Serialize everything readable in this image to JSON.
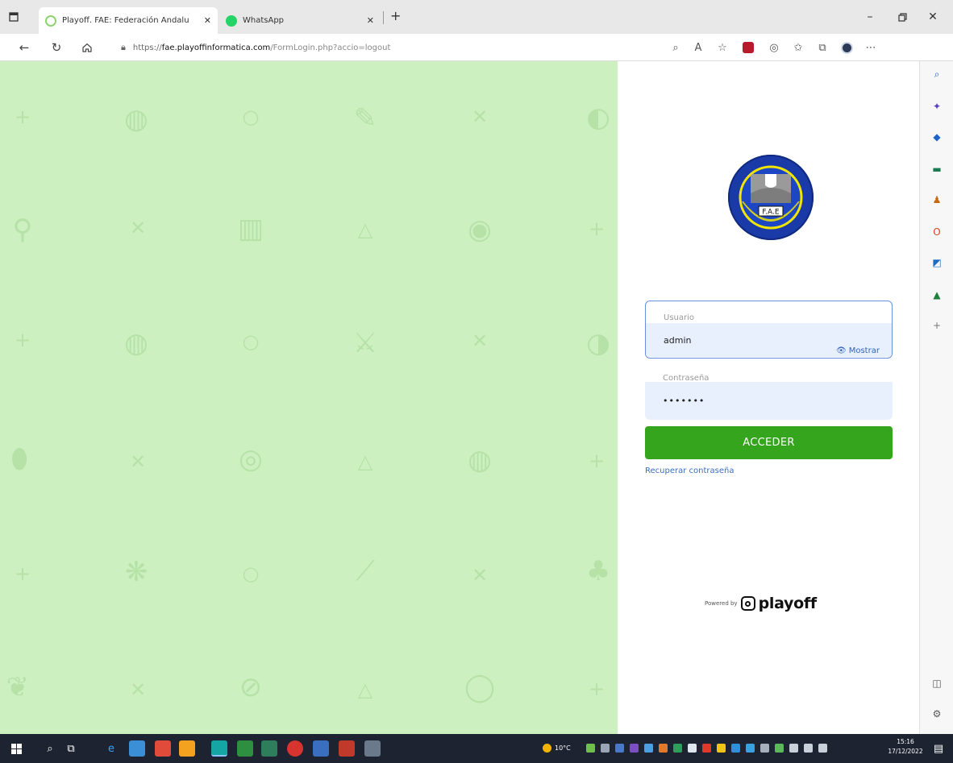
{
  "browser": {
    "tabs": [
      {
        "title": "Playoff. FAE: Federación Andalu",
        "active": true,
        "favicon_color": "#8ed36f"
      },
      {
        "title": "WhatsApp",
        "active": false,
        "favicon_color": "#25d366"
      }
    ],
    "address": {
      "scheme": "https://",
      "host": "fae.playoffinformatica.com",
      "path": "/FormLogin.php?accio=logout"
    }
  },
  "login": {
    "username_label": "Usuario",
    "username_value": "admin",
    "password_label": "Contraseña",
    "password_value": "•••••••",
    "show_label": "Mostrar",
    "submit_label": "ACCEDER",
    "recover_label": "Recuperar contraseña",
    "logo_text": "F.A.E",
    "powered_by": "Powered by",
    "brand": "playoff"
  },
  "taskbar": {
    "weather": "10°C",
    "time": "15:16",
    "date": "17/12/2022"
  },
  "colors": {
    "left_panel": "#cdf0c1",
    "accent_button": "#35a51e",
    "link": "#3a6fc0"
  }
}
